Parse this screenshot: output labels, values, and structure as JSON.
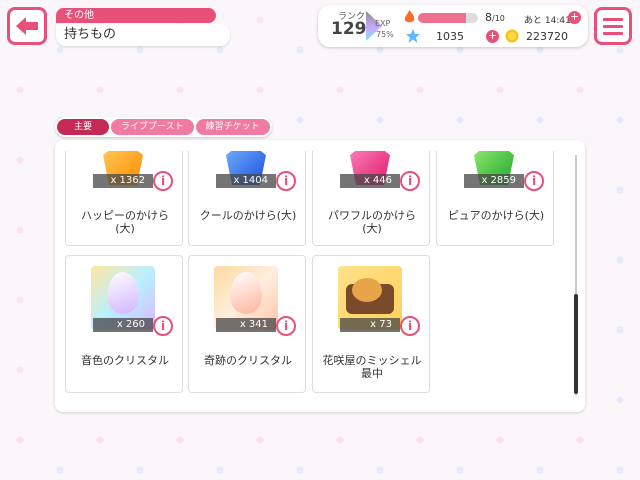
{
  "header": {
    "category": "その他",
    "title": "持ちもの"
  },
  "status": {
    "rank_label": "ランク",
    "rank": "129",
    "exp_label": "EXP",
    "exp_percent": "75%",
    "live_count": "8",
    "live_max": "/10",
    "live_time": "あと 14:41",
    "stars": "1035",
    "coins": "223720"
  },
  "tabs": [
    {
      "label": "主要"
    },
    {
      "label": "ライブブースト"
    },
    {
      "label": "練習チケット"
    }
  ],
  "items": [
    {
      "name": "ハッピーのかけら(大)",
      "count": "x 1362",
      "color": "#ff9a1f"
    },
    {
      "name": "クールのかけら(大)",
      "count": "x 1404",
      "color": "#2f6cff"
    },
    {
      "name": "パワフルのかけら(大)",
      "count": "x 446",
      "color": "#ff3c8a"
    },
    {
      "name": "ピュアのかけら(大)",
      "count": "x 2859",
      "color": "#3fcf4f"
    },
    {
      "name": "音色のクリスタル",
      "count": "x 260",
      "color": "#c9a8ff"
    },
    {
      "name": "奇跡のクリスタル",
      "count": "x 341",
      "color": "#ffb89a"
    },
    {
      "name": "花咲屋のミッシェル最中",
      "count": "x 73",
      "color": "#f0a838"
    }
  ]
}
